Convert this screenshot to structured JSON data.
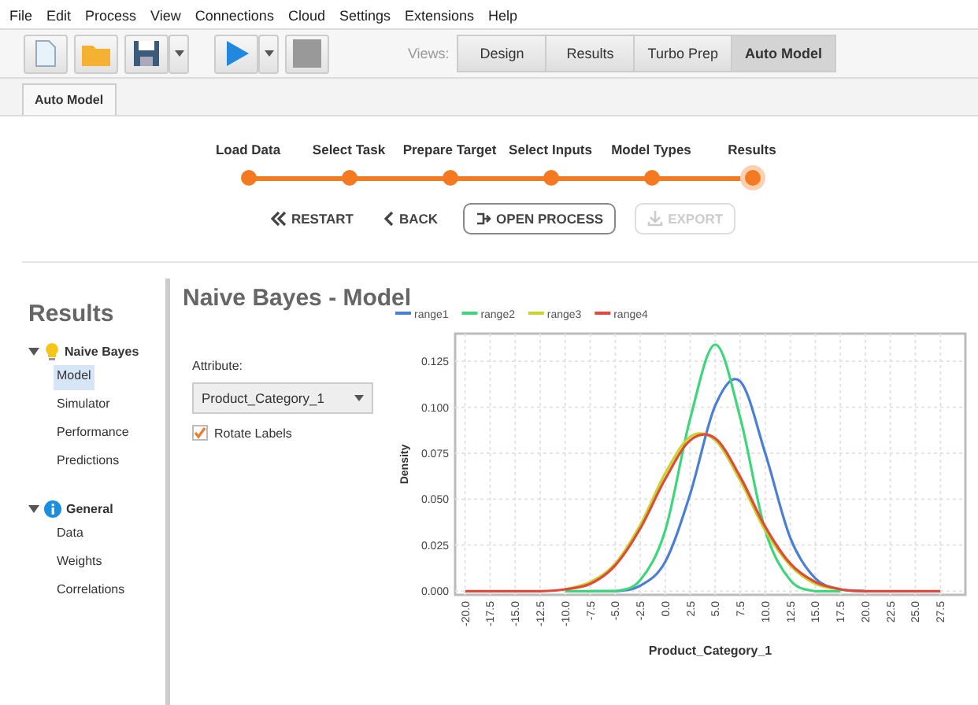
{
  "menu": [
    "File",
    "Edit",
    "Process",
    "View",
    "Connections",
    "Cloud",
    "Settings",
    "Extensions",
    "Help"
  ],
  "toolbar": [
    {
      "kind": "new"
    },
    {
      "kind": "open"
    },
    {
      "kind": "save",
      "dropdown": true
    },
    {
      "kind": "run",
      "dropdown": true
    },
    {
      "kind": "stop"
    }
  ],
  "views": {
    "label": "Views:",
    "items": [
      {
        "label": "Design",
        "selected": false
      },
      {
        "label": "Results",
        "selected": false
      },
      {
        "label": "Turbo Prep",
        "selected": false
      },
      {
        "label": "Auto Model",
        "selected": true
      }
    ]
  },
  "tab": {
    "label": "Auto Model"
  },
  "steps": [
    {
      "label": "Load Data",
      "current": false
    },
    {
      "label": "Select Task",
      "current": false
    },
    {
      "label": "Prepare Target",
      "current": false
    },
    {
      "label": "Select Inputs",
      "current": false
    },
    {
      "label": "Model Types",
      "current": false
    },
    {
      "label": "Results",
      "current": true
    }
  ],
  "actions": [
    {
      "kind": "restart",
      "label": "RESTART",
      "disabled": false
    },
    {
      "kind": "back",
      "label": "BACK",
      "disabled": false
    },
    {
      "kind": "open",
      "label": "OPEN PROCESS",
      "disabled": false
    },
    {
      "kind": "export",
      "label": "EXPORT",
      "disabled": true
    }
  ],
  "sidebar": {
    "title": "Results",
    "groups": [
      {
        "label": "Naive Bayes",
        "kind": "bulb",
        "expanded": true,
        "items": [
          {
            "label": "Model",
            "selected": true
          },
          {
            "label": "Simulator",
            "selected": false
          },
          {
            "label": "Performance",
            "selected": false
          },
          {
            "label": "Predictions",
            "selected": false
          }
        ]
      },
      {
        "label": "General",
        "kind": "info",
        "expanded": true,
        "items": [
          {
            "label": "Data",
            "selected": false
          },
          {
            "label": "Weights",
            "selected": false
          },
          {
            "label": "Correlations",
            "selected": false
          }
        ]
      }
    ]
  },
  "main": {
    "title": "Naive Bayes - Model",
    "attribute_label": "Attribute:",
    "attribute_value": "Product_Category_1",
    "rotate_labels": {
      "label": "Rotate Labels",
      "checked": true
    },
    "chart_data": {
      "type": "line",
      "xlabel": "Product_Category_1",
      "ylabel": "Density",
      "x": [
        -20,
        -17.5,
        -15,
        -12.5,
        -10,
        -7.5,
        -5,
        -2.5,
        0,
        2.5,
        5,
        7.5,
        10,
        12.5,
        15,
        17.5,
        20,
        22.5,
        25,
        27.5
      ],
      "series": [
        {
          "name": "range1",
          "color": "#4a7fd4",
          "values": [
            null,
            null,
            null,
            null,
            null,
            0,
            0,
            0.003,
            0.016,
            0.053,
            0.101,
            0.114,
            0.075,
            0.029,
            0.007,
            0.001,
            0,
            null,
            null,
            null
          ]
        },
        {
          "name": "range2",
          "color": "#3ed67a",
          "values": [
            null,
            null,
            null,
            null,
            0,
            0,
            0,
            0.006,
            0.033,
            0.094,
            0.134,
            0.094,
            0.033,
            0.006,
            0,
            0,
            null,
            null,
            null,
            null
          ]
        },
        {
          "name": "range3",
          "color": "#c8d42a",
          "values": [
            null,
            null,
            null,
            null,
            0.001,
            0.005,
            0.015,
            0.036,
            0.064,
            0.084,
            0.082,
            0.06,
            0.033,
            0.014,
            0.004,
            0.001,
            null,
            null,
            null,
            null
          ]
        },
        {
          "name": "range4",
          "color": "#e04a3a",
          "values": [
            0,
            0,
            0,
            0,
            0.001,
            0.004,
            0.014,
            0.034,
            0.061,
            0.082,
            0.083,
            0.062,
            0.035,
            0.015,
            0.005,
            0.001,
            0,
            0,
            0,
            0
          ]
        }
      ],
      "xlim": [
        -21,
        30
      ],
      "ylim": [
        -0.002,
        0.14
      ],
      "grid": true,
      "legend": true,
      "xticks": [
        {
          "value": -20,
          "label": "-20.0"
        },
        -17.5,
        {
          "value": -15,
          "label": "-15.0"
        },
        -12.5,
        {
          "value": -10,
          "label": "-10.0"
        },
        -7.5,
        {
          "value": -5,
          "label": "-5.0"
        },
        -2.5,
        {
          "value": 0,
          "label": "0.0"
        },
        2.5,
        {
          "value": 5,
          "label": "5.0"
        },
        7.5,
        {
          "value": 10,
          "label": "10.0"
        },
        12.5,
        {
          "value": 15,
          "label": "15.0"
        },
        17.5,
        {
          "value": 20,
          "label": "20.0"
        },
        22.5,
        {
          "value": 25,
          "label": "25.0"
        },
        27.5
      ],
      "yticks": [
        {
          "value": 0,
          "label": "0.000"
        },
        0.025,
        {
          "value": 0.05,
          "label": "0.050"
        },
        0.075,
        {
          "value": 0.1,
          "label": "0.100"
        },
        0.125
      ]
    }
  }
}
